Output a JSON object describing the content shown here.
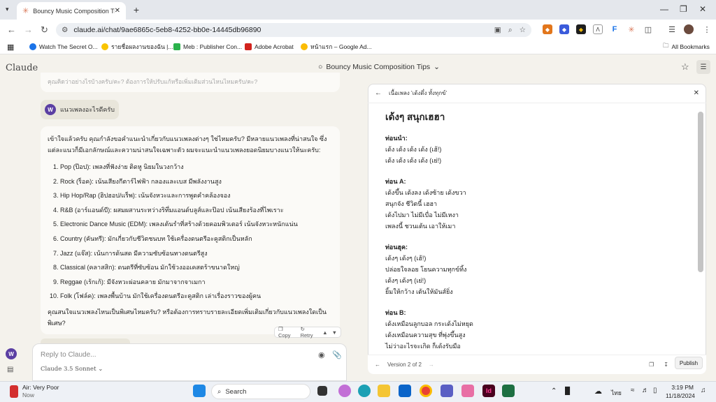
{
  "browser": {
    "tab_title": "Bouncy Music Composition Tips",
    "url": "claude.ai/chat/9ae6865c-5eb8-4252-bb0e-14445db96890",
    "bookmarks": [
      "Watch The Secret O...",
      "รายชื่อผลงานของฉัน |...",
      "Meb : Publisher Con...",
      "Adobe Acrobat",
      "หน้าแรก – Google Ad..."
    ],
    "all_bookmarks": "All Bookmarks"
  },
  "app": {
    "logo": "Claude",
    "chat_title": "Bouncy Music Composition Tips",
    "prev_fade": "คุณคิดว่าอย่างไรบ้างครับ/คะ? ต้องการให้ปรับแก้หรือเพิ่มเติมส่วนไหนไหมครับ/คะ?",
    "user_avatar": "W",
    "user_message": "แนวเพลงอะไรดีครับ",
    "reply_intro": "เข้าใจแล้วครับ คุณกำลังขอคำแนะนำเกี่ยวกับแนวเพลงต่างๆ ใช่ไหมครับ? มีหลายแนวเพลงที่น่าสนใจ ซึ่งแต่ละแนวก็มีเอกลักษณ์และความน่าสนใจเฉพาะตัว ผมจะแนะนำแนวเพลงยอดนิยมบางแนวให้นะครับ:",
    "genres": [
      "Pop (ป๊อป): เพลงที่ฟังง่าย ติดหู นิยมในวงกว้าง",
      "Rock (ร็อค): เน้นเสียงกีตาร์ไฟฟ้า กลองและเบส มีพลังงานสูง",
      "Hip Hop/Rap (ฮิปฮอป/แร็พ): เน้นจังหวะและการพูดคำคล้องจอง",
      "R&B (อาร์แอนด์บี): ผสมผสานระหว่างริทึ่มแอนด์บลูส์และป๊อป เน้นเสียงร้องที่ไพเราะ",
      "Electronic Dance Music (EDM): เพลงเต้นรำที่สร้างด้วยคอมพิวเตอร์ เน้นจังหวะหนักแน่น",
      "Country (คันทรี): มักเกี่ยวกับชีวิตชนบท ใช้เครื่องดนตรีอะคูสติกเป็นหลัก",
      "Jazz (แจ๊ส): เน้นการด้นสด มีความซับซ้อนทางดนตรีสูง",
      "Classical (คลาสสิก): ดนตรีที่ซับซ้อน มักใช้วงออเคสตร้าขนาดใหญ่",
      "Reggae (เร้กเก้): มีจังหวะผ่อนคลาย มักมาจากจาเมกา",
      "Folk (โฟล์ค): เพลงพื้นบ้าน มักใช้เครื่องดนตรีอะคูสติก เล่าเรื่องราวของผู้คน"
    ],
    "reply_outro": "คุณสนใจแนวเพลงไหนเป็นพิเศษไหมครับ? หรือต้องการทราบรายละเอียดเพิ่มเติมเกี่ยวกับแนวเพลงใดเป็นพิเศษ?",
    "copy": "Copy",
    "retry": "Retry",
    "input_placeholder": "Reply to Claude...",
    "model": "Claude 3.5 Sonnet"
  },
  "artifact": {
    "header": "เนื้อเพลง 'เด้งดึ๋ง ทั้งทุกข์'",
    "title": "เด้งๆ สนุกเฮฮา",
    "sections": [
      {
        "heading": "ท่อนนำ:",
        "lines": [
          "เด้ง เด้ง เด้ง เด้ง (เฮ้!)",
          "เด้ง เด้ง เด้ง เด้ง (เย่!)"
        ]
      },
      {
        "heading": "ท่อน A:",
        "lines": [
          "เด้งขึ้น เด้งลง เด้งซ้าย เด้งขวา",
          "สนุกจัง ชีวิตนี้ เฮฮา",
          "เด้งไปมา ไม่มีเบื่อ ไม่มีเหงา",
          "เพลงนี้ ชวนเต้น เอาให้เมา"
        ]
      },
      {
        "heading": "ท่อนฮุค:",
        "lines": [
          "เด้งๆ เด้งๆ (เฮ้!)",
          "ปล่อยใจลอย โยนความทุกข์ทิ้ง",
          "เด้งๆ เด้งๆ (เย่!)",
          "ยิ้มให้กว้าง เต้นให้มันส์ยิ่ง"
        ]
      },
      {
        "heading": "ท่อน B:",
        "lines": [
          "เด้งเหมือนลูกบอล กระเด้งไม่หยุด",
          "เด้งเหมือนความสุข ที่พุ่งขึ้นสูง",
          "ไม่ว่าอะไรจะเกิด ก็เด้งรับมือ"
        ]
      }
    ],
    "version": "Version 2 of 2",
    "publish": "Publish"
  },
  "taskbar": {
    "weather_title": "Air: Very Poor",
    "weather_sub": "Now",
    "search": "Search",
    "lang": "ไทย",
    "time": "3:19 PM",
    "date": "11/18/2024"
  }
}
